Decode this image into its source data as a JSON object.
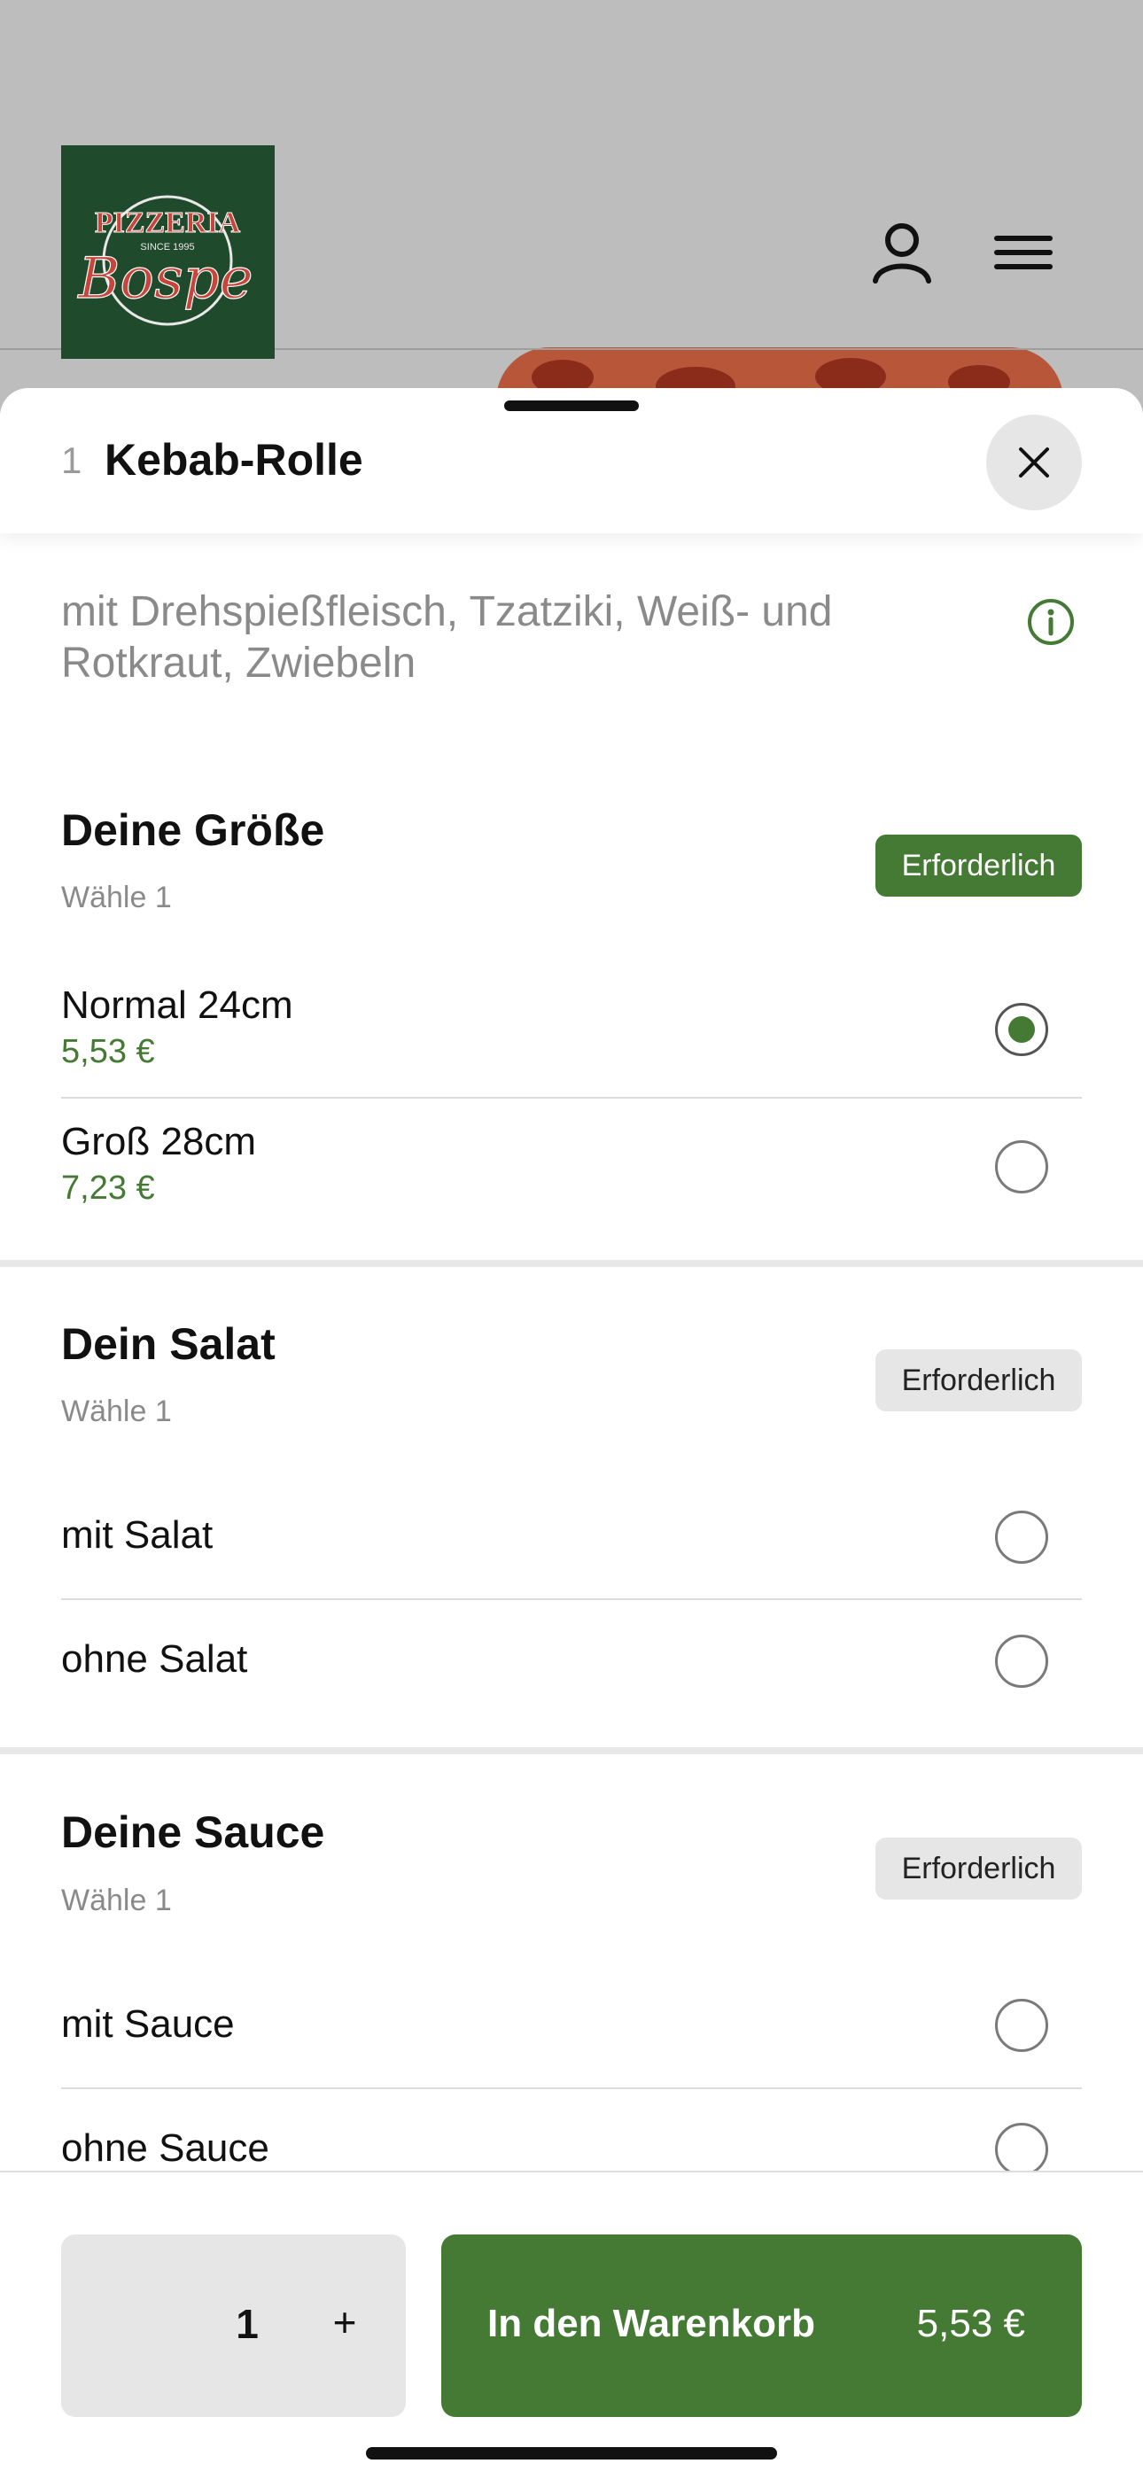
{
  "header": {
    "logo_text_top": "PIZZERIA",
    "logo_text_since": "SINCE 1995",
    "logo_text_script": "Bospe",
    "account_icon": "user-icon",
    "menu_icon": "hamburger-menu-icon"
  },
  "item": {
    "number": "1",
    "title": "Kebab-Rolle",
    "description": "mit Drehspießfleisch, Tzatziki, Weiß- und Rotkraut, Zwiebeln",
    "close_icon": "close-icon",
    "info_icon": "info-icon"
  },
  "groups": [
    {
      "title": "Deine Größe",
      "subtitle": "Wähle 1",
      "badge": "Erforderlich",
      "badge_state": "active",
      "options": [
        {
          "label": "Normal 24cm",
          "price": "5,53 €",
          "selected": true
        },
        {
          "label": "Groß 28cm",
          "price": "7,23 €",
          "selected": false
        }
      ]
    },
    {
      "title": "Dein Salat",
      "subtitle": "Wähle 1",
      "badge": "Erforderlich",
      "badge_state": "inactive",
      "options": [
        {
          "label": "mit Salat",
          "selected": false
        },
        {
          "label": "ohne Salat",
          "selected": false
        }
      ]
    },
    {
      "title": "Deine Sauce",
      "subtitle": "Wähle 1",
      "badge": "Erforderlich",
      "badge_state": "inactive",
      "options": [
        {
          "label": "mit Sauce",
          "selected": false
        },
        {
          "label": "ohne Sauce",
          "selected": false
        }
      ]
    }
  ],
  "footer": {
    "quantity": "1",
    "plus_label": "+",
    "cart_label": "In den Warenkorb",
    "cart_price": "5,53 €"
  },
  "colors": {
    "accent": "#447a34",
    "logo_bg": "#1f4a2b",
    "logo_red": "#c8453c",
    "badge_inactive": "#e6e6e6"
  }
}
